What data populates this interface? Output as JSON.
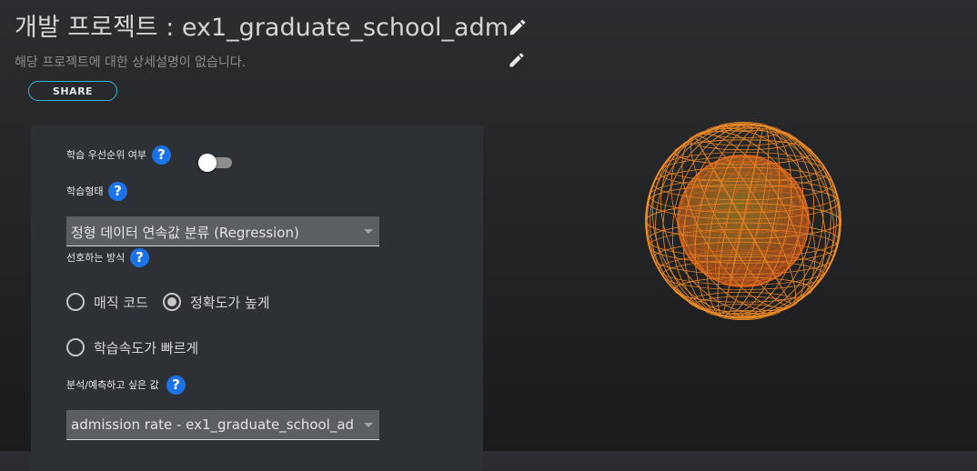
{
  "header": {
    "title": "개발 프로젝트 : ex1_graduate_school_adm",
    "description": "해당 프로젝트에 대한 상세설명이 없습니다.",
    "share_label": "SHARE"
  },
  "form": {
    "priority_label": "학습 우선순위 여부",
    "priority_enabled": false,
    "type_label": "학습형태",
    "type_value": "정형 데이터 연속값 분류 (Regression)",
    "preference_label": "선호하는 방식",
    "preference_options": [
      "매직 코드",
      "정확도가 높게",
      "학습속도가 빠르게"
    ],
    "preference_selected": "정확도가 높게",
    "target_label": "분석/예측하고 싶은 값",
    "target_value": "admission rate - ex1_graduate_school_ad..."
  },
  "icons": {
    "help": "?",
    "edit": "pencil-icon"
  },
  "colors": {
    "accent_blue": "#1a73e8",
    "share_border": "#2ab7d8",
    "sphere_outer": "#f08a24",
    "sphere_inner": "#e8641c"
  }
}
